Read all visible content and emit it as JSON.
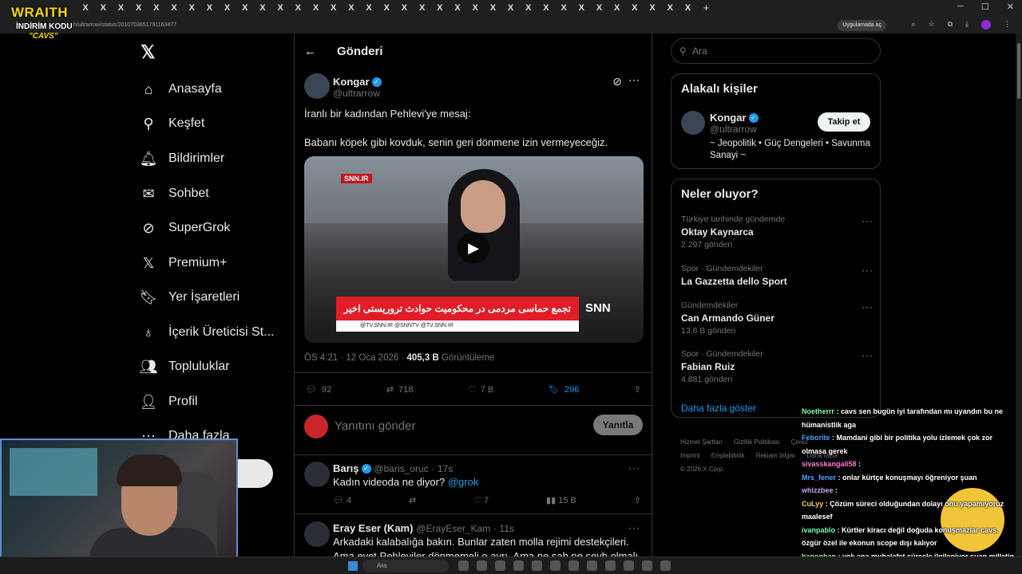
{
  "browser": {
    "tabs_count_glyph": "X",
    "address": "h/ultrarrow/status/2010703651791163477",
    "app_chip": "Uygulamada aç",
    "new_tab": "+"
  },
  "stream_overlay": {
    "brand": "WRAITH",
    "promo": "İNDİRİM KODU",
    "code": "\"CAVS\""
  },
  "sidebar": {
    "items": [
      {
        "label": "Anasayfa",
        "icon": "home-icon"
      },
      {
        "label": "Keşfet",
        "icon": "search-icon"
      },
      {
        "label": "Bildirimler",
        "icon": "bell-icon"
      },
      {
        "label": "Sohbet",
        "icon": "mail-icon"
      },
      {
        "label": "SuperGrok",
        "icon": "grok-icon"
      },
      {
        "label": "Premium+",
        "icon": "x-icon"
      },
      {
        "label": "Yer İşaretleri",
        "icon": "bookmark-icon"
      },
      {
        "label": "İçerik Üreticisi St...",
        "icon": "creator-icon"
      },
      {
        "label": "Topluluklar",
        "icon": "people-icon"
      },
      {
        "label": "Profil",
        "icon": "person-icon"
      },
      {
        "label": "Daha fazla",
        "icon": "more-icon"
      }
    ]
  },
  "main": {
    "header_title": "Gönderi",
    "post": {
      "name": "Kongar",
      "handle": "@ultrarrow",
      "line1": "İranlı bir kadından Pehlevi'ye mesaj:",
      "line2": "Babanı köpek gibi kovduk, senin geri dönmene izin vermeyeceğiz.",
      "video_banner": "تجمع حماسی مردمی در محکومیت حوادث تروریستی اخیر",
      "video_ticker": "@TV.SNN.IR   @SNNTV   @TV.SNN.IR",
      "video_logo": "SNN",
      "video_site": "SNN.IR",
      "time": "ÖS 4:21 · 12 Oca 2026 · ",
      "views": "405,3 B",
      "views_label": " Görüntüleme",
      "replies": "92",
      "reposts": "718",
      "likes": "7 B",
      "bookmarks": "296"
    },
    "reply_box": {
      "placeholder": "Yanıtını gönder",
      "button": "Yanıtla"
    },
    "replies": [
      {
        "name": "Barış",
        "handle": "@baris_oruc",
        "age": "· 17s",
        "text": "Kadın videoda ne diyor? ",
        "mention": "@grok",
        "replies": "4",
        "reposts": "",
        "likes": "7",
        "views": "15 B"
      },
      {
        "name": "Eray Eser (Kam)",
        "handle": "@ErayEser_Kam",
        "age": "· 11s",
        "text": "Arkadaki kalabalığa bakın. Bunlar zaten molla rejimi destekçileri. Ama evet Pehleviler dönmemeli o ayrı. Ama ne şah ne şeyh olmalı motto. Komşumuz"
      }
    ]
  },
  "right": {
    "search_placeholder": "Ara",
    "related": {
      "title": "Alakalı kişiler",
      "name": "Kongar",
      "handle": "@ultrarrow",
      "bio": "~ Jeopolitik • Güç Dengeleri • Savunma Sanayi ~",
      "follow": "Takip et"
    },
    "trends": {
      "title": "Neler oluyor?",
      "items": [
        {
          "context": "Türkiye tarihinde gündemde",
          "title": "Oktay Kaynarca",
          "count": "2.297 gönderi"
        },
        {
          "context": "Spor · Gündemdekiler",
          "title": "La Gazzetta dello Sport",
          "count": ""
        },
        {
          "context": "Gündemdekiler",
          "title": "Can Armando Güner",
          "count": "13,6 B gönderi"
        },
        {
          "context": "Spor · Gündemdekiler",
          "title": "Fabian Ruiz",
          "count": "4.881 gönderi"
        }
      ],
      "show_more": "Daha fazla göster"
    },
    "footer": [
      "Hizmet Şartları",
      "Gizlilik Politikası",
      "Çerez",
      "Imprint",
      "Erişilebilirlik",
      "Reklam bilgisi",
      "Daha fazla ...",
      "© 2026 X Corp."
    ]
  },
  "chat": [
    {
      "user": "Noetherrr",
      "msg": ": cavs sen bugün iyi tarafından mı uyandın bu ne hümanistlik aga"
    },
    {
      "user": "Feborite",
      "msg": ": Mamdani gibi bir politika yolu izlemek çok zor olmasa gerek"
    },
    {
      "user": "sivasskangali58",
      "msg": ":"
    },
    {
      "user": "Mrs_fener",
      "msg": ": onlar kürtçe konuşmayı öğreniyor şuan"
    },
    {
      "user": "whizzbee",
      "msg": ":"
    },
    {
      "user": "CuLyy",
      "msg": ": Çözüm süreci olduğundan dolayı onu yapamıyoruz maalesef"
    },
    {
      "user": "ivanpablo",
      "msg": ": Kürtler kiracı değil doğuda konuşmazlar cavs. özgür özel ile ekonun scope dışı kalıyor"
    },
    {
      "user": "hanonhan",
      "msg": ": yok ana muhalefet süreçle ilgileniyor şuan milletin derdiyle uğraşırlar mı .d"
    }
  ],
  "taskbar": {
    "search": "Ara"
  }
}
